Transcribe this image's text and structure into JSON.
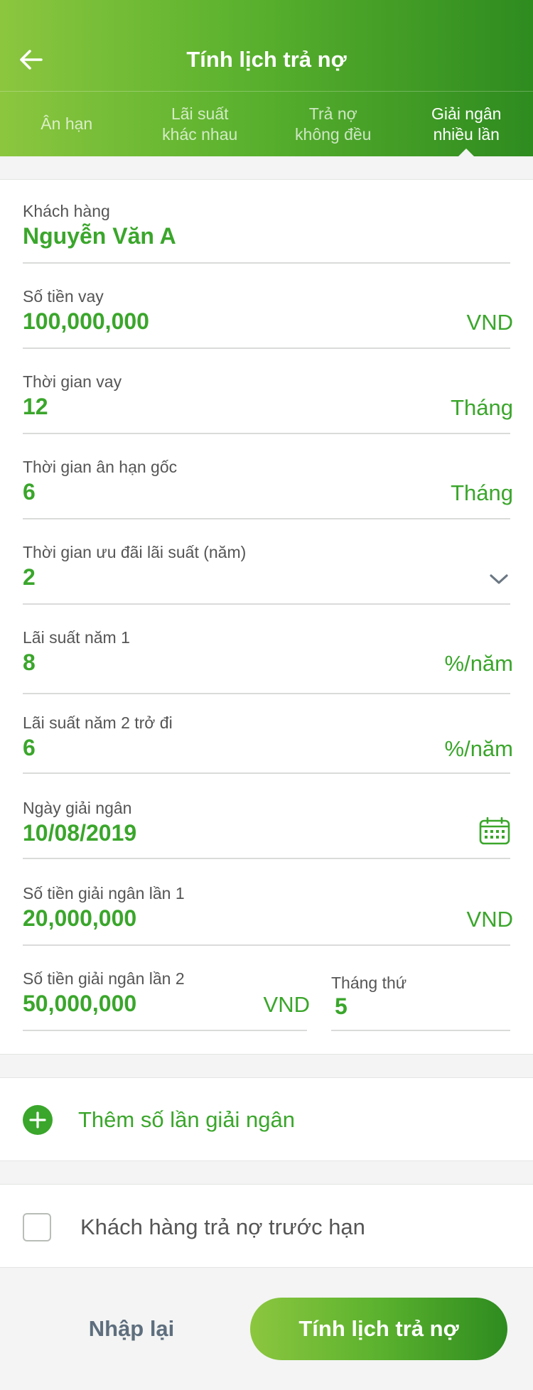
{
  "header": {
    "title": "Tính lịch trả nợ",
    "back_icon": "arrow-left-icon"
  },
  "tabs": [
    {
      "label": "Ân hạn",
      "active": false
    },
    {
      "label": "Lãi suất\nkhác nhau",
      "active": false
    },
    {
      "label": "Trả nợ\nkhông đều",
      "active": false
    },
    {
      "label": "Giải ngân\nnhiều lần",
      "active": true
    }
  ],
  "form": {
    "customer": {
      "label": "Khách hàng",
      "value": "Nguyễn Văn A"
    },
    "loan_amount": {
      "label": "Số tiền vay",
      "value": "100,000,000",
      "unit": "VND"
    },
    "loan_term": {
      "label": "Thời gian vay",
      "value": "12",
      "unit": "Tháng"
    },
    "grace_period": {
      "label": "Thời gian ân hạn gốc",
      "value": "6",
      "unit": "Tháng"
    },
    "promo_period": {
      "label": "Thời gian ưu đãi lãi suất (năm)",
      "value": "2",
      "icon": "chevron-down-icon"
    },
    "rate_year1": {
      "label": "Lãi suất năm 1",
      "value": "8",
      "unit": "%/năm"
    },
    "rate_year2": {
      "label": "Lãi suất năm 2  trở đi",
      "value": "6",
      "unit": "%/năm"
    },
    "disbursement_date": {
      "label": "Ngày giải ngân",
      "value": "10/08/2019",
      "icon": "calendar-icon"
    },
    "disbursement_1": {
      "label": "Số tiền giải ngân lần 1",
      "value": "20,000,000",
      "unit": "VND"
    },
    "disbursement_2": {
      "label": "Số tiền giải ngân lần 2",
      "value": "50,000,000",
      "unit": "VND"
    },
    "month_index": {
      "label": "Tháng thứ",
      "value": "5"
    }
  },
  "add_disbursement": {
    "label": "Thêm số lần giải ngân",
    "icon": "plus-circle-icon"
  },
  "early_repayment": {
    "label": "Khách hàng trả nợ trước hạn",
    "checked": false
  },
  "buttons": {
    "reset": "Nhập lại",
    "submit": "Tính lịch trả nợ"
  },
  "colors": {
    "brand_green": "#3aa62b",
    "gradient_start": "#8cc63f",
    "gradient_end": "#2e8b1f",
    "reset_text": "#5e6e7e"
  }
}
